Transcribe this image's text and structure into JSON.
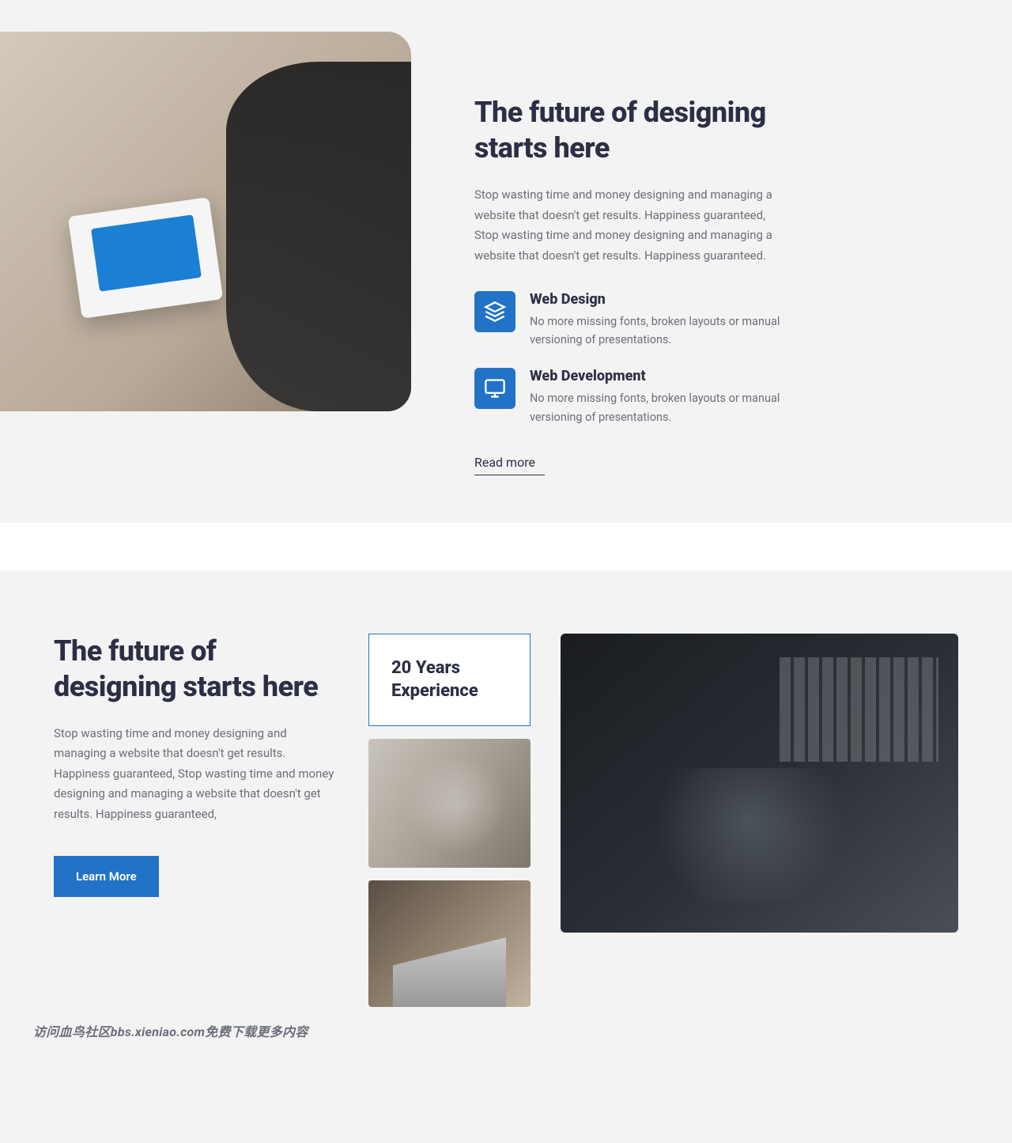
{
  "section1": {
    "heading": "The future of designing starts here",
    "body": "Stop wasting time and money designing and managing a website that doesn't get results. Happiness guaranteed, Stop wasting time and money designing and managing a website that doesn't get results. Happiness guaranteed.",
    "features": [
      {
        "icon": "layers-icon",
        "title": "Web Design",
        "desc": "No more missing fonts, broken layouts or manual versioning of presentations."
      },
      {
        "icon": "monitor-icon",
        "title": "Web Development",
        "desc": "No more missing fonts, broken layouts or manual versioning of presentations."
      }
    ],
    "readMore": "Read more"
  },
  "section2": {
    "heading": "The future of designing starts here",
    "body": "Stop wasting time and money designing and managing a website that doesn't get results. Happiness guaranteed, Stop wasting time and money designing and managing a website that doesn't get results. Happiness guaranteed,",
    "cta": "Learn More",
    "experienceCard": "20 Years Experience"
  },
  "watermark": "访问血鸟社区bbs.xieniao.com免费下载更多内容",
  "colors": {
    "accent": "#2273c7",
    "heading": "#2c2f44",
    "bg": "#f3f3f3"
  }
}
